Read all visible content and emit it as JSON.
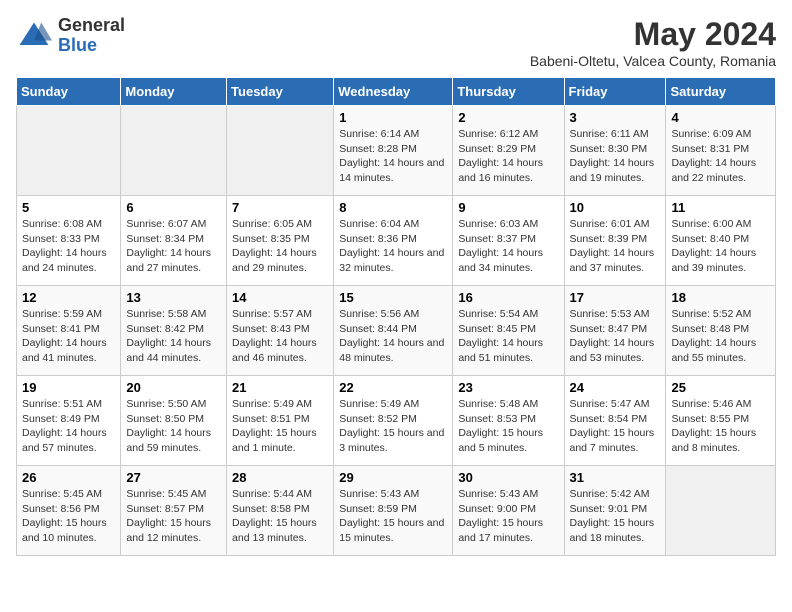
{
  "logo": {
    "general": "General",
    "blue": "Blue"
  },
  "title": "May 2024",
  "subtitle": "Babeni-Oltetu, Valcea County, Romania",
  "days_of_week": [
    "Sunday",
    "Monday",
    "Tuesday",
    "Wednesday",
    "Thursday",
    "Friday",
    "Saturday"
  ],
  "weeks": [
    [
      {
        "day": null
      },
      {
        "day": null
      },
      {
        "day": null
      },
      {
        "day": 1,
        "sunrise": "6:14 AM",
        "sunset": "8:28 PM",
        "daylight": "14 hours and 14 minutes."
      },
      {
        "day": 2,
        "sunrise": "6:12 AM",
        "sunset": "8:29 PM",
        "daylight": "14 hours and 16 minutes."
      },
      {
        "day": 3,
        "sunrise": "6:11 AM",
        "sunset": "8:30 PM",
        "daylight": "14 hours and 19 minutes."
      },
      {
        "day": 4,
        "sunrise": "6:09 AM",
        "sunset": "8:31 PM",
        "daylight": "14 hours and 22 minutes."
      }
    ],
    [
      {
        "day": 5,
        "sunrise": "6:08 AM",
        "sunset": "8:33 PM",
        "daylight": "14 hours and 24 minutes."
      },
      {
        "day": 6,
        "sunrise": "6:07 AM",
        "sunset": "8:34 PM",
        "daylight": "14 hours and 27 minutes."
      },
      {
        "day": 7,
        "sunrise": "6:05 AM",
        "sunset": "8:35 PM",
        "daylight": "14 hours and 29 minutes."
      },
      {
        "day": 8,
        "sunrise": "6:04 AM",
        "sunset": "8:36 PM",
        "daylight": "14 hours and 32 minutes."
      },
      {
        "day": 9,
        "sunrise": "6:03 AM",
        "sunset": "8:37 PM",
        "daylight": "14 hours and 34 minutes."
      },
      {
        "day": 10,
        "sunrise": "6:01 AM",
        "sunset": "8:39 PM",
        "daylight": "14 hours and 37 minutes."
      },
      {
        "day": 11,
        "sunrise": "6:00 AM",
        "sunset": "8:40 PM",
        "daylight": "14 hours and 39 minutes."
      }
    ],
    [
      {
        "day": 12,
        "sunrise": "5:59 AM",
        "sunset": "8:41 PM",
        "daylight": "14 hours and 41 minutes."
      },
      {
        "day": 13,
        "sunrise": "5:58 AM",
        "sunset": "8:42 PM",
        "daylight": "14 hours and 44 minutes."
      },
      {
        "day": 14,
        "sunrise": "5:57 AM",
        "sunset": "8:43 PM",
        "daylight": "14 hours and 46 minutes."
      },
      {
        "day": 15,
        "sunrise": "5:56 AM",
        "sunset": "8:44 PM",
        "daylight": "14 hours and 48 minutes."
      },
      {
        "day": 16,
        "sunrise": "5:54 AM",
        "sunset": "8:45 PM",
        "daylight": "14 hours and 51 minutes."
      },
      {
        "day": 17,
        "sunrise": "5:53 AM",
        "sunset": "8:47 PM",
        "daylight": "14 hours and 53 minutes."
      },
      {
        "day": 18,
        "sunrise": "5:52 AM",
        "sunset": "8:48 PM",
        "daylight": "14 hours and 55 minutes."
      }
    ],
    [
      {
        "day": 19,
        "sunrise": "5:51 AM",
        "sunset": "8:49 PM",
        "daylight": "14 hours and 57 minutes."
      },
      {
        "day": 20,
        "sunrise": "5:50 AM",
        "sunset": "8:50 PM",
        "daylight": "14 hours and 59 minutes."
      },
      {
        "day": 21,
        "sunrise": "5:49 AM",
        "sunset": "8:51 PM",
        "daylight": "15 hours and 1 minute."
      },
      {
        "day": 22,
        "sunrise": "5:49 AM",
        "sunset": "8:52 PM",
        "daylight": "15 hours and 3 minutes."
      },
      {
        "day": 23,
        "sunrise": "5:48 AM",
        "sunset": "8:53 PM",
        "daylight": "15 hours and 5 minutes."
      },
      {
        "day": 24,
        "sunrise": "5:47 AM",
        "sunset": "8:54 PM",
        "daylight": "15 hours and 7 minutes."
      },
      {
        "day": 25,
        "sunrise": "5:46 AM",
        "sunset": "8:55 PM",
        "daylight": "15 hours and 8 minutes."
      }
    ],
    [
      {
        "day": 26,
        "sunrise": "5:45 AM",
        "sunset": "8:56 PM",
        "daylight": "15 hours and 10 minutes."
      },
      {
        "day": 27,
        "sunrise": "5:45 AM",
        "sunset": "8:57 PM",
        "daylight": "15 hours and 12 minutes."
      },
      {
        "day": 28,
        "sunrise": "5:44 AM",
        "sunset": "8:58 PM",
        "daylight": "15 hours and 13 minutes."
      },
      {
        "day": 29,
        "sunrise": "5:43 AM",
        "sunset": "8:59 PM",
        "daylight": "15 hours and 15 minutes."
      },
      {
        "day": 30,
        "sunrise": "5:43 AM",
        "sunset": "9:00 PM",
        "daylight": "15 hours and 17 minutes."
      },
      {
        "day": 31,
        "sunrise": "5:42 AM",
        "sunset": "9:01 PM",
        "daylight": "15 hours and 18 minutes."
      },
      {
        "day": null
      }
    ]
  ],
  "labels": {
    "sunrise": "Sunrise:",
    "sunset": "Sunset:",
    "daylight": "Daylight:"
  },
  "colors": {
    "header_bg": "#2a6db5",
    "header_text": "#ffffff",
    "logo_blue": "#2a6db5"
  }
}
